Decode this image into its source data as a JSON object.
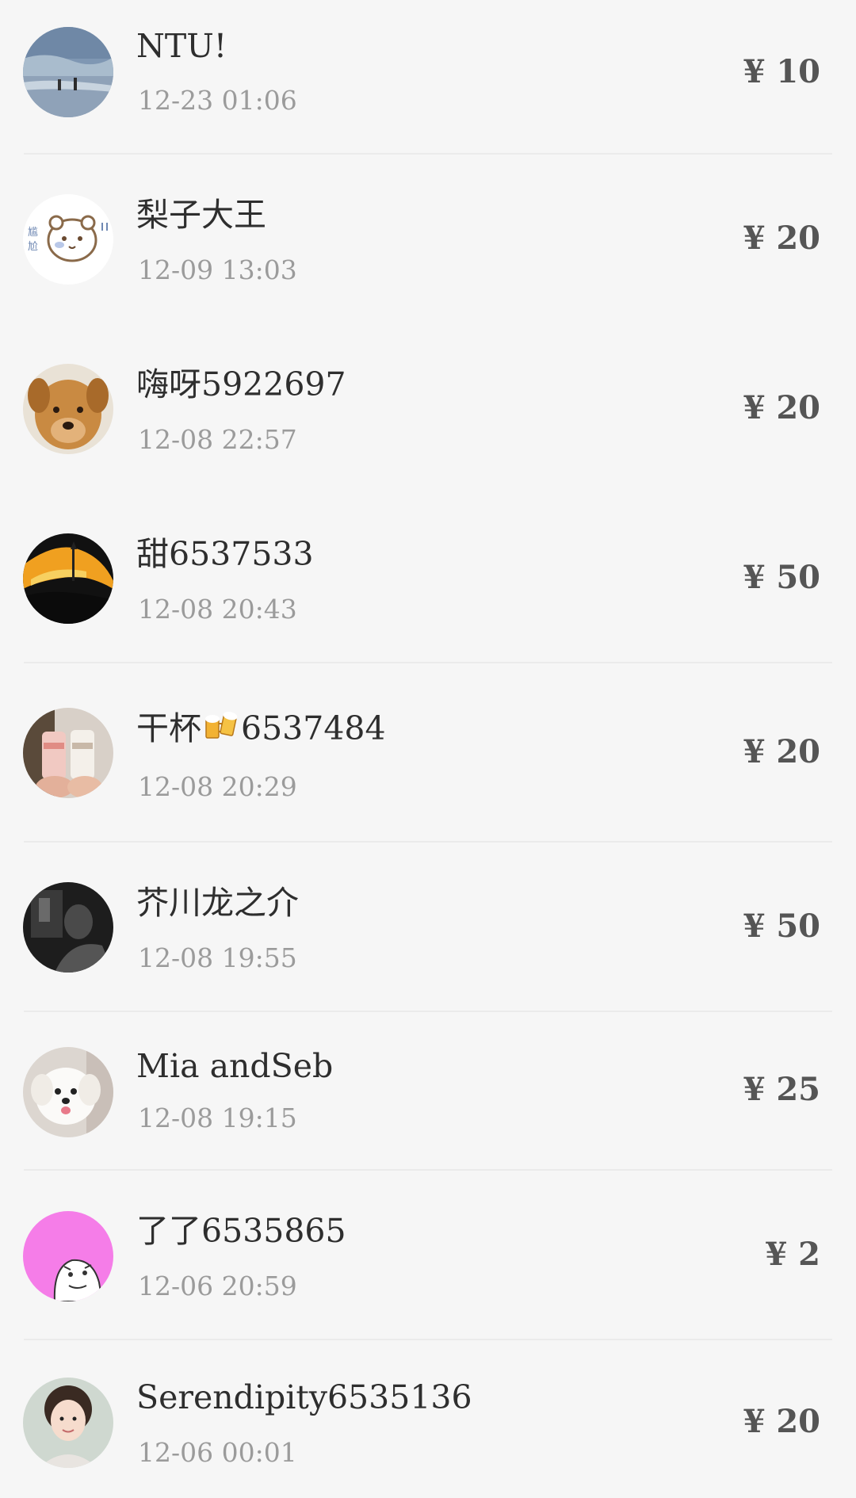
{
  "transactions": [
    {
      "name": "NTU!",
      "time": "12-23 01:06",
      "amount": "¥ 10",
      "avatar": "seaside-photo-avatar"
    },
    {
      "name": "梨子大王",
      "time": "12-09 13:03",
      "amount": "¥ 20",
      "avatar": "cartoon-bear-avatar"
    },
    {
      "name": "嗨呀5922697",
      "time": "12-08 22:57",
      "amount": "¥ 20",
      "avatar": "dog-avatar"
    },
    {
      "name": "甜6537533",
      "time": "12-08 20:43",
      "amount": "¥ 50",
      "avatar": "sunset-avatar"
    },
    {
      "name_prefix": "干杯",
      "name_suffix": "6537484",
      "emoji": "beer-mugs-emoji",
      "time": "12-08 20:29",
      "amount": "¥ 20",
      "avatar": "drinks-photo-avatar"
    },
    {
      "name": "芥川龙之介",
      "time": "12-08 19:55",
      "amount": "¥ 50",
      "avatar": "dark-photo-avatar"
    },
    {
      "name": "Mia andSeb",
      "time": "12-08 19:15",
      "amount": "¥ 25",
      "avatar": "white-puppy-avatar"
    },
    {
      "name": "了了6535865",
      "time": "12-06 20:59",
      "amount": "¥ 2",
      "avatar": "pink-cartoon-face-avatar"
    },
    {
      "name": "Serendipity6535136",
      "time": "12-06 00:01",
      "amount": "¥ 20",
      "avatar": "girl-portrait-avatar"
    }
  ],
  "colors": {
    "background": "#f6f6f6",
    "divider": "#ebebeb",
    "name_text": "#2e2e2e",
    "time_text": "#9b9b9b",
    "amount_text": "#555555"
  }
}
